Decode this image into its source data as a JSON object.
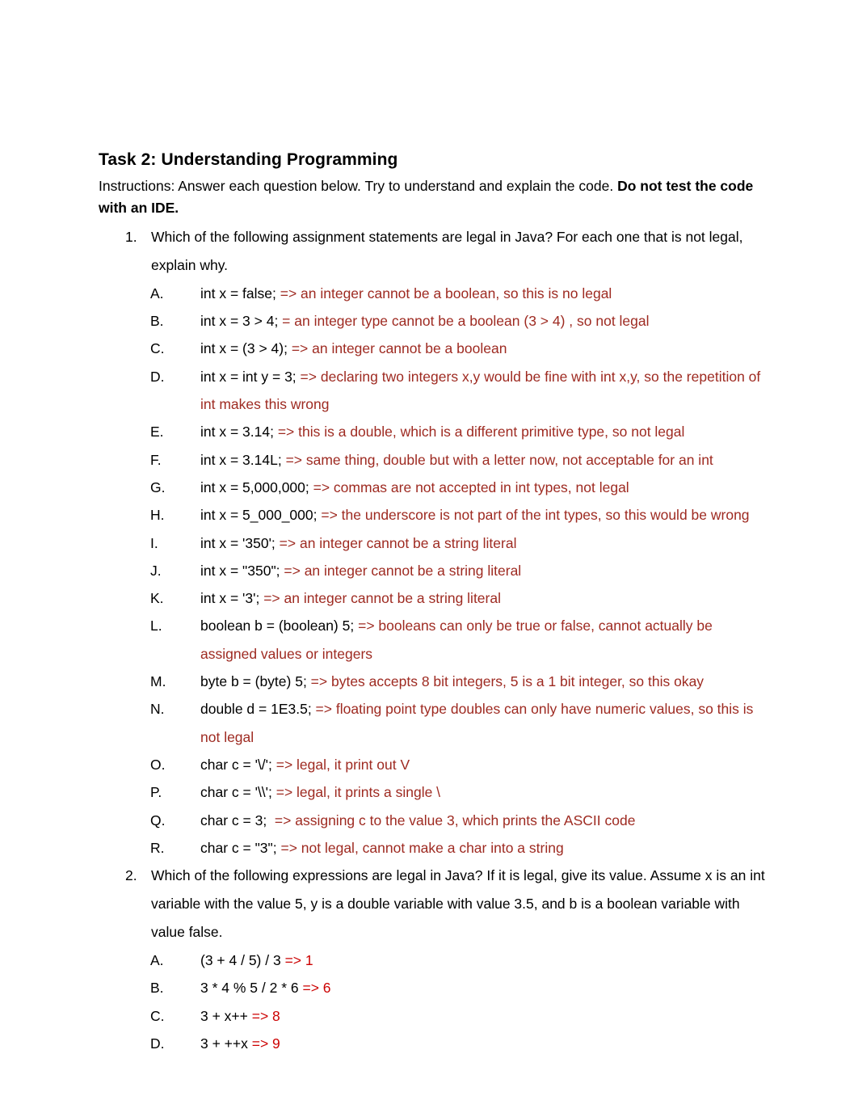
{
  "document": {
    "title": "Task 2: Understanding Programming",
    "instructions_plain": "Instructions: Answer each question below. Try to understand and explain the code. ",
    "instructions_bold": "Do not test the code with an IDE.",
    "colors": {
      "answer_red_q1": "#9E2A21",
      "answer_red_q2": "#CC0000",
      "body_text": "#000000",
      "page_background": "#FFFFFF"
    }
  },
  "questions": [
    {
      "number": "1.",
      "prompt": "Which of the following assignment statements are legal in Java? For each one that is not legal, explain why.",
      "items": [
        {
          "letter": "A.",
          "statement": "int x = false; ",
          "answer": "=> an integer cannot be a boolean, so this is no legal"
        },
        {
          "letter": "B.",
          "statement": "int x = 3 > 4; ",
          "answer": "= an integer type cannot be a boolean (3 > 4) , so not legal"
        },
        {
          "letter": "C.",
          "statement": "int x = (3 > 4); ",
          "answer": "=> an integer cannot be a boolean"
        },
        {
          "letter": "D.",
          "statement": "int x = int y = 3; ",
          "answer": "=> declaring two integers x,y would be fine with int x,y, so the repetition of int makes this wrong"
        },
        {
          "letter": "E.",
          "statement": "int x = 3.14; ",
          "answer": "=> this is a double, which is a different primitive type, so not legal"
        },
        {
          "letter": "F.",
          "statement": "int x = 3.14L; ",
          "answer": "=> same thing, double but with a letter now, not acceptable for an int"
        },
        {
          "letter": "G.",
          "statement": "int x = 5,000,000; ",
          "answer": "=> commas are not accepted in int types, not legal"
        },
        {
          "letter": "H.",
          "statement": "int x = 5_000_000; ",
          "answer": "=> the underscore is not part of the int types, so this would be wrong"
        },
        {
          "letter": "I.",
          "statement": "int x = '350'; ",
          "answer": "=> an integer cannot be a string literal"
        },
        {
          "letter": "J.",
          "statement": "int x = \"350\"; ",
          "answer": "=> an integer cannot be a string literal"
        },
        {
          "letter": "K.",
          "statement": "int x = '3'; ",
          "answer": "=> an integer cannot be a string literal"
        },
        {
          "letter": "L.",
          "statement": "boolean b = (boolean) 5; ",
          "answer": "=> booleans can only be true or false, cannot actually be assigned values or integers"
        },
        {
          "letter": "M.",
          "statement": "byte b = (byte) 5; ",
          "answer": "=> bytes accepts 8 bit integers, 5 is a 1 bit integer, so this okay"
        },
        {
          "letter": "N.",
          "statement": "double d = 1E3.5; ",
          "answer": "=> floating point type doubles can only have numeric values, so this is not legal"
        },
        {
          "letter": "O.",
          "statement": "char c = '\\/'; ",
          "answer": "=> legal, it print out V"
        },
        {
          "letter": "P.",
          "statement": "char c = '\\\\'; ",
          "answer": "=> legal, it prints a single \\"
        },
        {
          "letter": "Q.",
          "statement": "char c = 3;  ",
          "answer": "=> assigning c to the value 3, which prints the ASCII code"
        },
        {
          "letter": "R.",
          "statement": "char c = \"3\"; ",
          "answer": "=> not legal, cannot make a char into a string"
        }
      ]
    },
    {
      "number": "2.",
      "prompt": "Which of the following expressions are legal in Java? If it is legal, give its value. Assume x is an int variable with the value 5, y is a double variable with value 3.5, and b is a boolean variable with value false.",
      "items": [
        {
          "letter": "A.",
          "statement": "(3 + 4 / 5) / 3 ",
          "answer": "=> 1"
        },
        {
          "letter": "B.",
          "statement": "3 * 4 % 5 / 2 * 6 ",
          "answer": "=> 6"
        },
        {
          "letter": "C.",
          "statement": "3 + x++ ",
          "answer": "=> 8"
        },
        {
          "letter": "D.",
          "statement": "3 + ++x ",
          "answer": "=> 9"
        }
      ]
    }
  ]
}
